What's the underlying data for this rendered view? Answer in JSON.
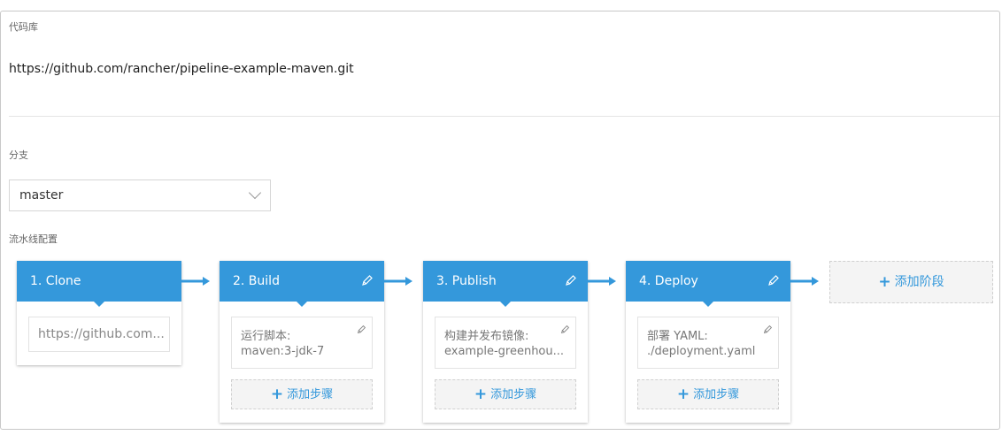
{
  "repo": {
    "label": "代码库",
    "url": "https://github.com/rancher/pipeline-example-maven.git"
  },
  "branch": {
    "label": "分支",
    "selected": "master"
  },
  "pipeline": {
    "label": "流水线配置",
    "stages": [
      {
        "title": "1. Clone",
        "step": {
          "text": "https://github.com..."
        }
      },
      {
        "title": "2. Build",
        "step": {
          "line1": "运行脚本:",
          "line2": "maven:3-jdk-7"
        },
        "add_step": "添加步骤"
      },
      {
        "title": "3. Publish",
        "step": {
          "line1": "构建并发布镜像:",
          "line2": "example-greenhou..."
        },
        "add_step": "添加步骤"
      },
      {
        "title": "4. Deploy",
        "step": {
          "line1": "部署  YAML:",
          "line2": "./deployment.yaml"
        },
        "add_step": "添加步骤"
      }
    ],
    "add_stage": "添加阶段"
  },
  "colors": {
    "accent": "#3498db"
  },
  "icons": {
    "edit": "pencil-icon",
    "add": "plus-icon",
    "arrow": "arrow-right-icon",
    "dropdown": "chevron-down-icon"
  }
}
